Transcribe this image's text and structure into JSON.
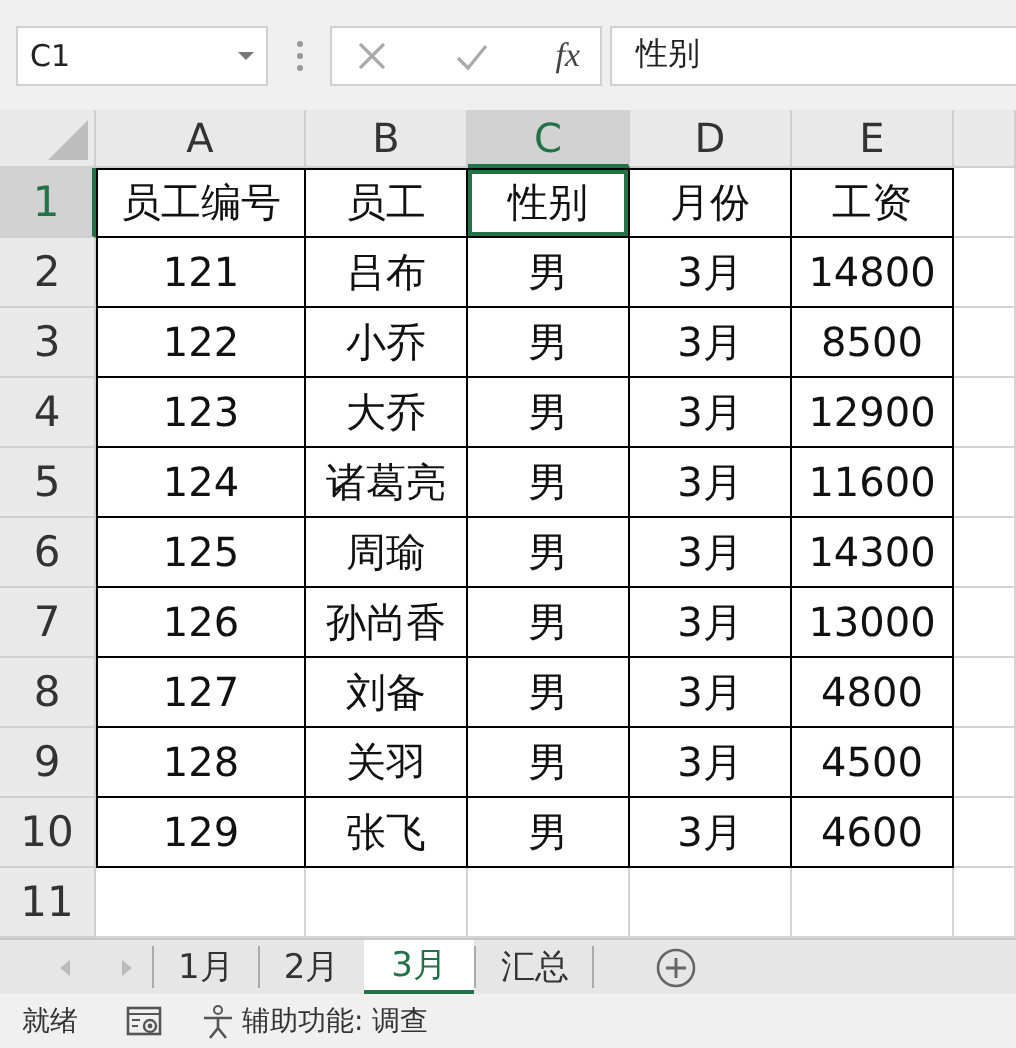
{
  "name_box": {
    "value": "C1"
  },
  "formula_bar": {
    "fx_label": "fx",
    "value": "性别"
  },
  "columns": [
    {
      "label": "A",
      "selected": false
    },
    {
      "label": "B",
      "selected": false
    },
    {
      "label": "C",
      "selected": true
    },
    {
      "label": "D",
      "selected": false
    },
    {
      "label": "E",
      "selected": false
    }
  ],
  "rows": [
    {
      "label": "1",
      "selected": true,
      "cells": [
        "员工编号",
        "员工",
        "性别",
        "月份",
        "工资"
      ]
    },
    {
      "label": "2",
      "selected": false,
      "cells": [
        "121",
        "吕布",
        "男",
        "3月",
        "14800"
      ]
    },
    {
      "label": "3",
      "selected": false,
      "cells": [
        "122",
        "小乔",
        "男",
        "3月",
        "8500"
      ]
    },
    {
      "label": "4",
      "selected": false,
      "cells": [
        "123",
        "大乔",
        "男",
        "3月",
        "12900"
      ]
    },
    {
      "label": "5",
      "selected": false,
      "cells": [
        "124",
        "诸葛亮",
        "男",
        "3月",
        "11600"
      ]
    },
    {
      "label": "6",
      "selected": false,
      "cells": [
        "125",
        "周瑜",
        "男",
        "3月",
        "14300"
      ]
    },
    {
      "label": "7",
      "selected": false,
      "cells": [
        "126",
        "孙尚香",
        "男",
        "3月",
        "13000"
      ]
    },
    {
      "label": "8",
      "selected": false,
      "cells": [
        "127",
        "刘备",
        "男",
        "3月",
        "4800"
      ]
    },
    {
      "label": "9",
      "selected": false,
      "cells": [
        "128",
        "关羽",
        "男",
        "3月",
        "4500"
      ]
    },
    {
      "label": "10",
      "selected": false,
      "cells": [
        "129",
        "张飞",
        "男",
        "3月",
        "4600"
      ]
    },
    {
      "label": "11",
      "selected": false
    }
  ],
  "sheet_tabs": [
    {
      "label": "1月",
      "selected": false
    },
    {
      "label": "2月",
      "selected": false
    },
    {
      "label": "3月",
      "selected": true
    },
    {
      "label": "汇总",
      "selected": false
    }
  ],
  "status_bar": {
    "mode": "就绪",
    "accessibility": "辅助功能: 调查"
  }
}
